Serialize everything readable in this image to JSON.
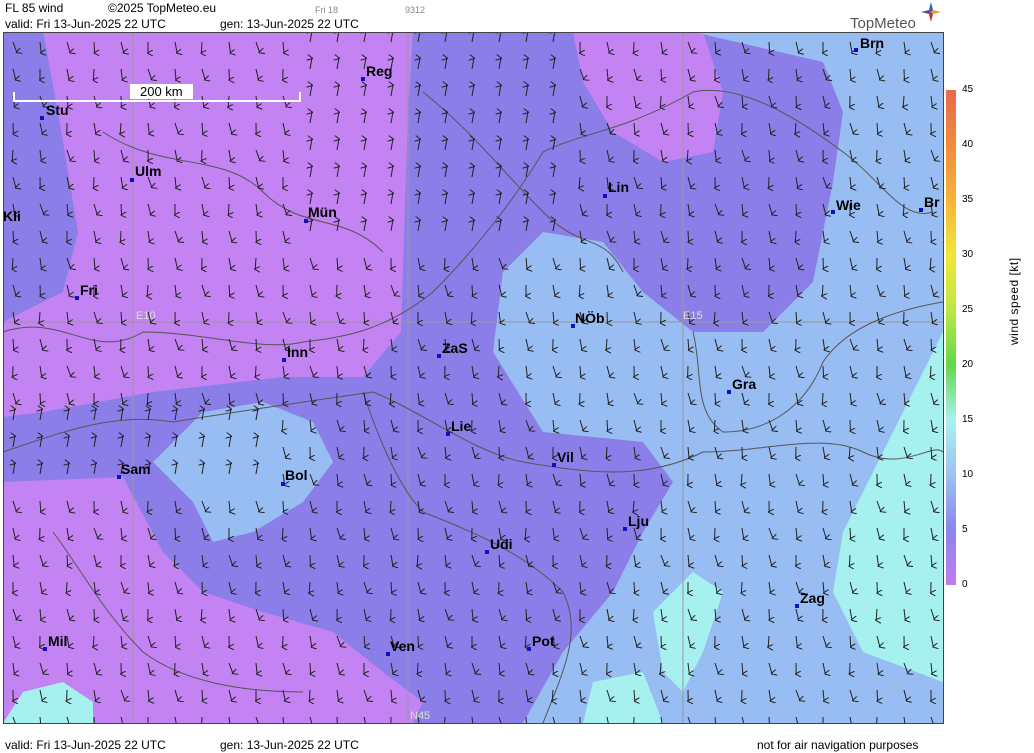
{
  "header": {
    "product": "FL 85 wind",
    "copyright": "©2025 TopMeteo.eu",
    "day_label": "Fri 18",
    "code": "9312",
    "valid": "valid:  Fri  13-Jun-2025  22 UTC",
    "gen": "gen: 13-Jun-2025  22 UTC"
  },
  "logo": {
    "text": "TopMeteo",
    "icon": "compass-star-icon"
  },
  "footer": {
    "valid": "valid:  Fri  13-Jun-2025  22 UTC",
    "gen": "gen: 13-Jun-2025  22 UTC",
    "disclaimer": "not for air navigation purposes"
  },
  "scale_bar": {
    "label": "200 km"
  },
  "grid_labels": {
    "e10": "E10",
    "e15": "E15",
    "n45": "N45"
  },
  "cities": [
    {
      "name": "Stu"
    },
    {
      "name": "Reg"
    },
    {
      "name": "Brn"
    },
    {
      "name": "Ulm"
    },
    {
      "name": "Lin"
    },
    {
      "name": "Wie"
    },
    {
      "name": "Br"
    },
    {
      "name": "Kli"
    },
    {
      "name": "Mün"
    },
    {
      "name": "Fri"
    },
    {
      "name": "NÖb"
    },
    {
      "name": "Inn"
    },
    {
      "name": "ZaS"
    },
    {
      "name": "Gra"
    },
    {
      "name": "Lie"
    },
    {
      "name": "Vil"
    },
    {
      "name": "Sam"
    },
    {
      "name": "Bol"
    },
    {
      "name": "Lju"
    },
    {
      "name": "Udi"
    },
    {
      "name": "Zag"
    },
    {
      "name": "Mil"
    },
    {
      "name": "Ven"
    },
    {
      "name": "Pot"
    }
  ],
  "legend": {
    "title": "wind  speed  [kt]",
    "ticks": [
      "45",
      "40",
      "35",
      "30",
      "25",
      "20",
      "15",
      "10",
      "5",
      "0"
    ],
    "colors": [
      "#e86a4c",
      "#f28a3c",
      "#f7b43a",
      "#f2e63a",
      "#bde846",
      "#62d84a",
      "#a8f2ee",
      "#9cc2f4",
      "#8a86ee",
      "#c07cf0"
    ]
  },
  "map_colors": {
    "purple": "#c383f2",
    "violet": "#8b7ee8",
    "blue": "#98bdf2",
    "cyan": "#a6f0f0"
  }
}
